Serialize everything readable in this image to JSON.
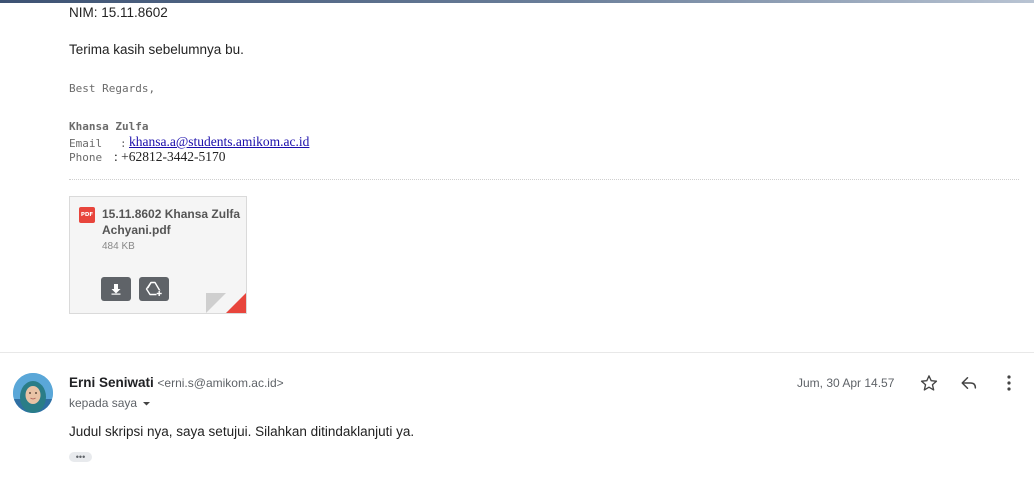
{
  "previous_message": {
    "nim_line": "NIM: 15.11.8602",
    "thanks": "Terima kasih sebelumnya bu.",
    "signature": {
      "regards": "Best Regards,",
      "name": "Khansa Zulfa",
      "email_label": "Email",
      "email_sep": ":",
      "email": "khansa.a@students.amikom.ac.id",
      "phone_label": "Phone",
      "phone_value": ": +62812-3442-5170"
    },
    "attachment": {
      "type_badge": "PDF",
      "name": "15.11.8602 Khansa Zulfa Achyani.pdf",
      "size": "484 KB",
      "download_icon": "download-icon",
      "drive_icon": "add-to-drive-icon",
      "badge_color": "#e8453c"
    }
  },
  "reply": {
    "sender_name": "Erni Seniwati",
    "sender_email": "<erni.s@amikom.ac.id>",
    "to_line": "kepada saya",
    "date": "Jum, 30 Apr 14.57",
    "body": "Judul skripsi nya, saya setujui. Silahkan ditindaklanjuti ya.",
    "more_label": "•••",
    "icons": {
      "star": "star-icon",
      "reply": "reply-icon",
      "more": "more-vert-icon",
      "dropdown": "arrow-drop-down-icon"
    }
  }
}
